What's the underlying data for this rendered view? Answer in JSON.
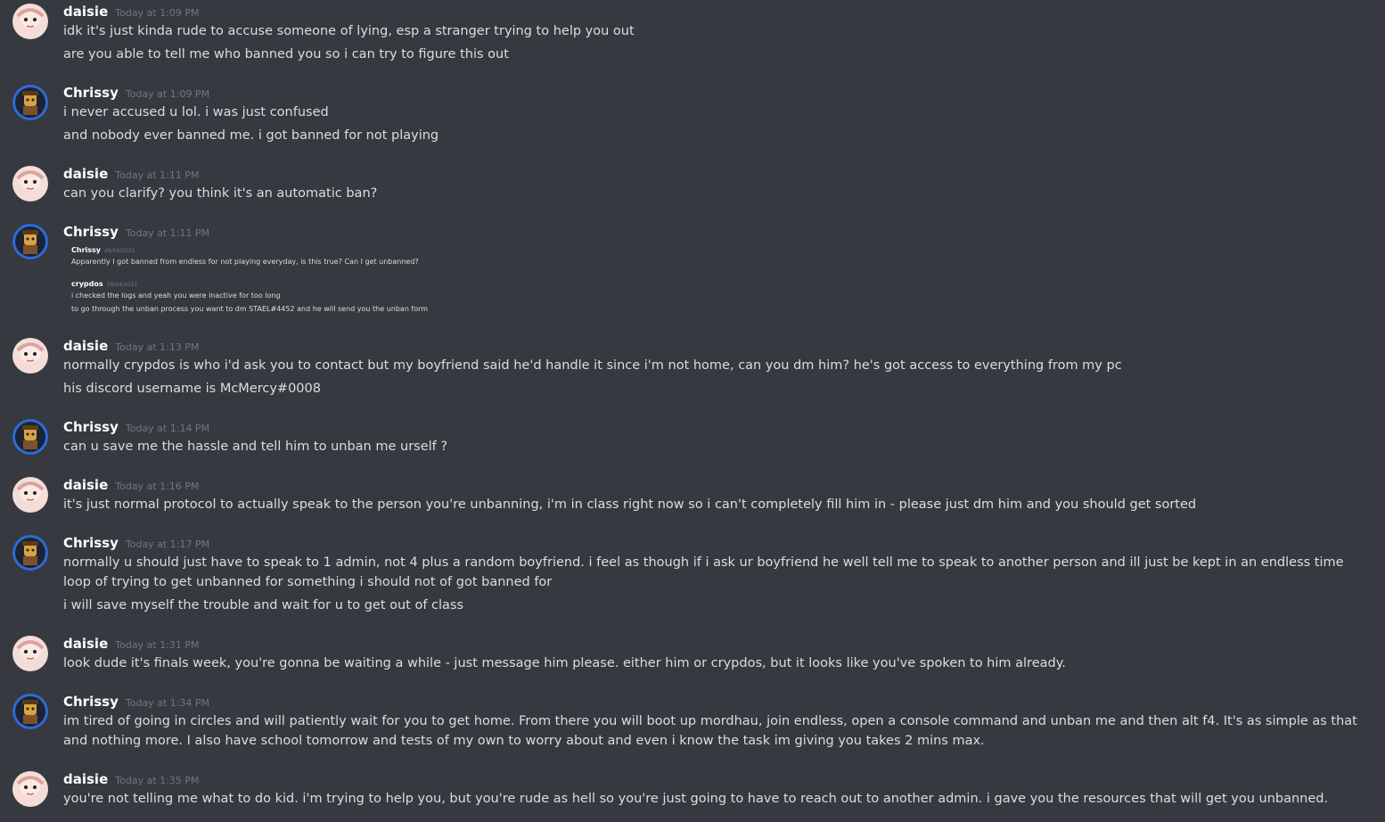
{
  "messages": [
    {
      "author": "daisie",
      "time": "Today at 1:09 PM",
      "lines": [
        "idk it's just kinda rude to accuse someone of lying, esp a stranger trying to help you out",
        "are you able to tell me who banned you so i can try to figure this out"
      ]
    },
    {
      "author": "Chrissy",
      "time": "Today at 1:09 PM",
      "lines": [
        "i never accused u lol. i was just confused",
        "and nobody ever banned me.  i got banned for not playing"
      ]
    },
    {
      "author": "daisie",
      "time": "Today at 1:11 PM",
      "lines": [
        "can you clarify?  you think it's an automatic ban?"
      ]
    },
    {
      "author": "Chrissy",
      "time": "Today at 1:11 PM",
      "embed": {
        "a_name": "Chrissy",
        "a_time": "26/04/2021",
        "a_text": "Apparently I got banned from endless for not playing everyday, is this true?  Can I get unbanned?",
        "b_name": "crypdos",
        "b_time": "26/04/2021",
        "b_line1": "i checked the logs and yeah you were inactive for too long",
        "b_line2": "to go through the unban process you want to dm STAEL#4452 and he will send you the unban form"
      }
    },
    {
      "author": "daisie",
      "time": "Today at 1:13 PM",
      "lines": [
        "normally crypdos is who i'd ask you to contact but my boyfriend said he'd handle it since i'm not home, can you dm him?  he's got access to everything from my pc",
        "his discord username is McMercy#0008"
      ]
    },
    {
      "author": "Chrissy",
      "time": "Today at 1:14 PM",
      "lines": [
        "can u save me the hassle and tell him to unban me urself ?"
      ]
    },
    {
      "author": "daisie",
      "time": "Today at 1:16 PM",
      "lines": [
        "it's just normal protocol to actually speak to the person you're unbanning, i'm in class right now so i can't completely fill him in - please just dm him and you should get sorted"
      ]
    },
    {
      "author": "Chrissy",
      "time": "Today at 1:17 PM",
      "lines": [
        "normally u should just have to speak to 1 admin, not 4 plus a random boyfriend.  i feel as though if i ask ur boyfriend he well tell me to speak to another person and ill just be kept in an endless time loop of trying to get unbanned for something i should not of got banned for",
        "i will save myself the trouble and wait for u to get out of class"
      ]
    },
    {
      "author": "daisie",
      "time": "Today at 1:31 PM",
      "lines": [
        "look dude it's finals week, you're gonna be waiting a while - just message him please.  either him or crypdos, but it looks like you've spoken to him already."
      ]
    },
    {
      "author": "Chrissy",
      "time": "Today at 1:34 PM",
      "lines": [
        "im tired of going in circles and will patiently wait for you to get home.  From there you will boot up mordhau, join endless, open a console command and unban me and then alt f4.  It's as simple as that and nothing more.  I also have school tomorrow and tests of my own to worry about and even i know the task im giving you takes 2 mins max."
      ]
    },
    {
      "author": "daisie",
      "time": "Today at 1:35 PM",
      "lines": [
        "you're not telling me what to do kid.  i'm trying to help you, but you're rude as hell so you're just going to have to reach out to another admin.  i gave you the resources that will get you unbanned."
      ]
    }
  ]
}
